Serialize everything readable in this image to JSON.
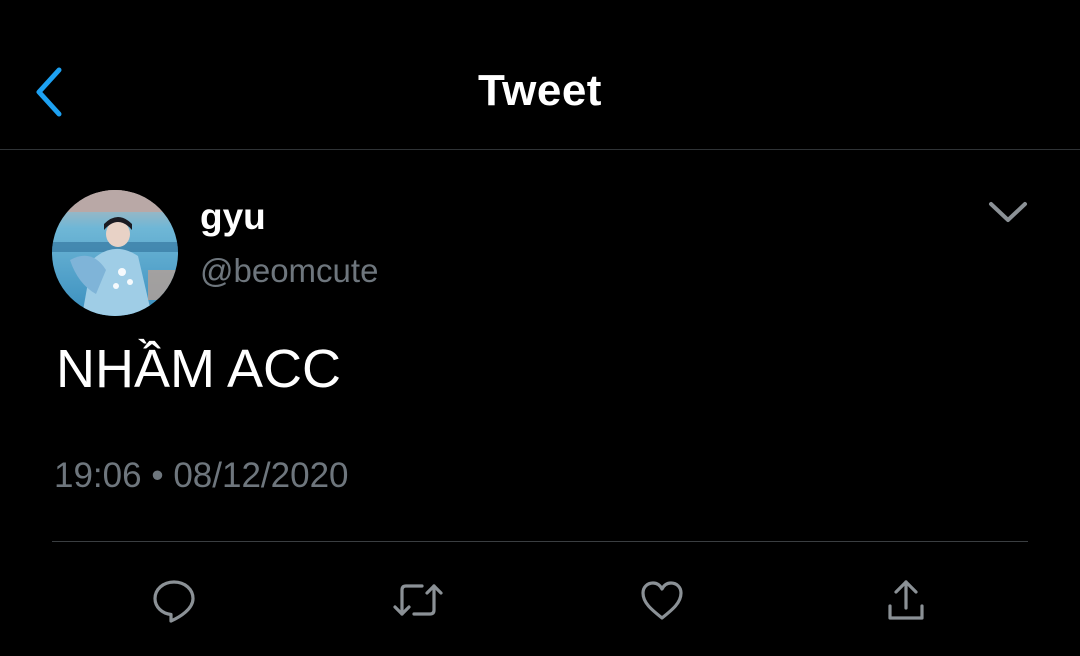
{
  "header": {
    "title": "Tweet",
    "back_icon": "chevron-left-icon"
  },
  "tweet": {
    "author": {
      "display_name": "gyu",
      "handle": "@beomcute"
    },
    "text": "NHẦM ACC",
    "time": "19:06",
    "separator": "•",
    "date": "08/12/2020",
    "more_icon": "chevron-down-icon"
  },
  "actions": [
    {
      "name": "reply",
      "icon": "comment-icon"
    },
    {
      "name": "retweet",
      "icon": "retweet-icon"
    },
    {
      "name": "like",
      "icon": "heart-icon"
    },
    {
      "name": "share",
      "icon": "share-icon"
    }
  ],
  "colors": {
    "background": "#000000",
    "accent": "#1da1f2",
    "primary_text": "#ffffff",
    "secondary_text": "#6e767d",
    "divider": "#2f3336"
  }
}
